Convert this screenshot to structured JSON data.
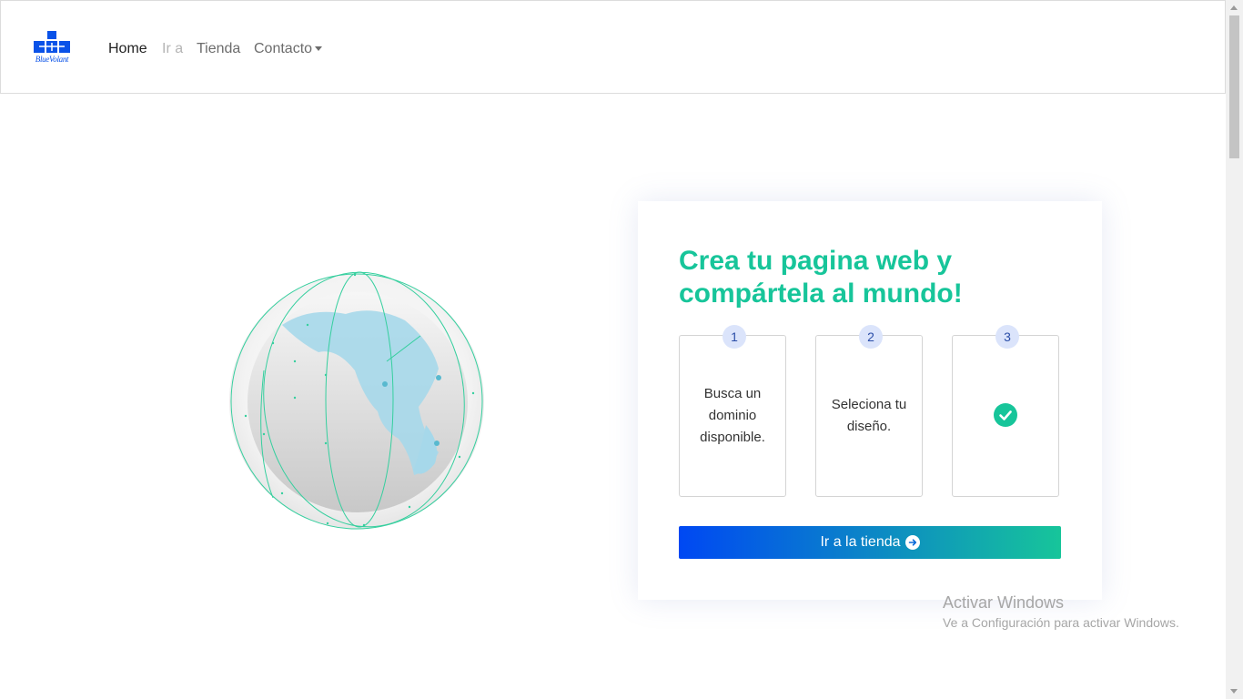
{
  "navbar": {
    "logo_text": "BlueVolant",
    "links": [
      {
        "label": "Home",
        "state": "active"
      },
      {
        "label": "Ir a",
        "state": "disabled"
      },
      {
        "label": "Tienda",
        "state": "normal"
      },
      {
        "label": "Contacto",
        "state": "dropdown"
      }
    ]
  },
  "hero": {
    "title": "Crea tu pagina web y compártela al mundo!",
    "steps": [
      {
        "number": "1",
        "text": "Busca un dominio disponible."
      },
      {
        "number": "2",
        "text": "Seleciona tu diseño."
      },
      {
        "number": "3",
        "text": "",
        "icon": "check-circle-icon"
      }
    ],
    "button_label": "Ir a la tienda",
    "button_icon": "arrow-right-circle-icon"
  },
  "watermark": {
    "title": "Activar Windows",
    "subtitle": "Ve a Configuración para activar Windows."
  },
  "colors": {
    "accent_green": "#17c59a",
    "brand_blue": "#0048f3",
    "step_badge": "#dbe4fb"
  }
}
